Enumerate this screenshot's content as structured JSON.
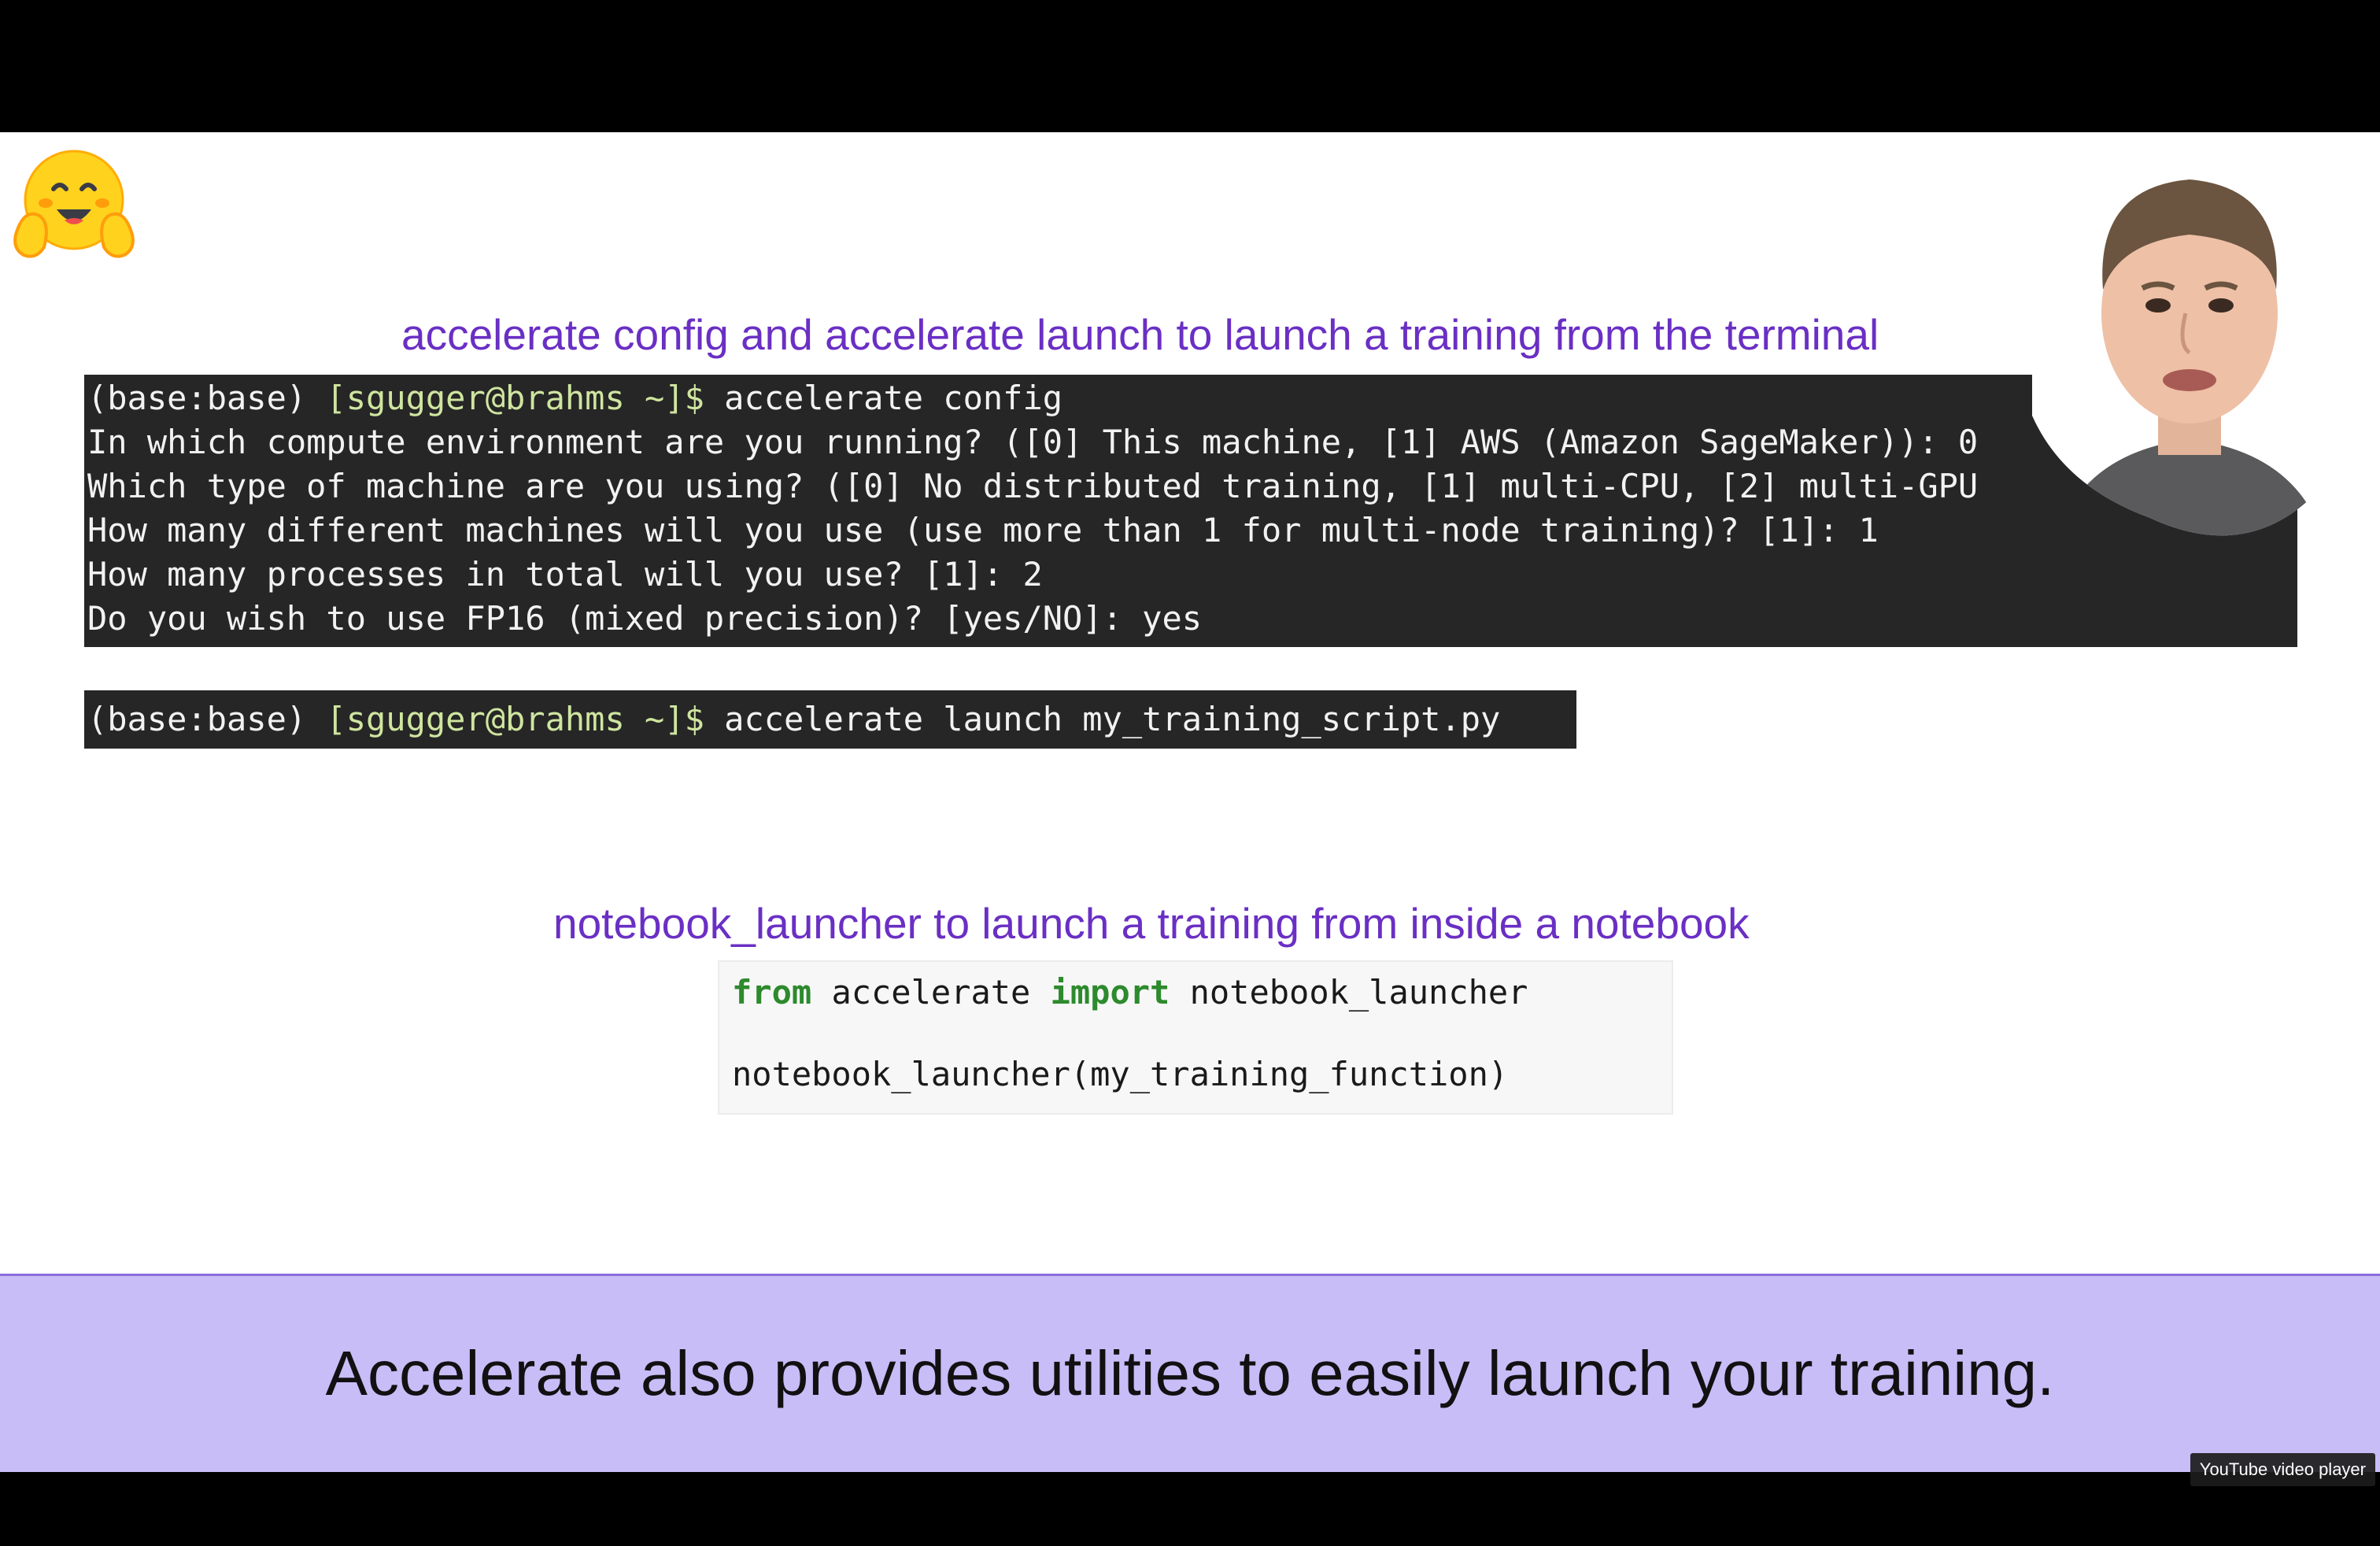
{
  "slide": {
    "title_terminal": "accelerate config and accelerate launch to launch a training from the terminal",
    "title_notebook": "notebook_launcher to launch a training from inside a notebook"
  },
  "terminal_config": {
    "prompt_base": "(base:base) ",
    "prompt_user": "[sgugger@brahms ~]$",
    "command": " accelerate config",
    "lines": [
      "In which compute environment are you running? ([0] This machine, [1] AWS (Amazon SageMaker)): 0",
      "Which type of machine are you using? ([0] No distributed training, [1] multi-CPU, [2] multi-GPU",
      "How many different machines will you use (use more than 1 for multi-node training)? [1]: 1",
      "How many processes in total will you use? [1]: 2",
      "Do you wish to use FP16 (mixed precision)? [yes/NO]: yes"
    ]
  },
  "terminal_launch": {
    "prompt_base": "(base:base) ",
    "prompt_user": "[sgugger@brahms ~]$",
    "command": " accelerate launch my_training_script.py"
  },
  "notebook_code": {
    "kw_from": "from",
    "module": " accelerate ",
    "kw_import": "import",
    "name": " notebook_launcher",
    "call": "notebook_launcher(my_training_function)"
  },
  "caption": {
    "text": "Accelerate also provides utilities to easily launch your training."
  },
  "player": {
    "label": "YouTube video player"
  },
  "colors": {
    "heading": "#6a2fc4",
    "terminal_bg": "#262626",
    "prompt_user": "#cfe5a0",
    "caption_bg": "#c8bdf7",
    "keyword": "#2d8a2d"
  },
  "icons": {
    "logo": "hugging-face-emoji-icon",
    "presenter": "presenter-webcam"
  }
}
